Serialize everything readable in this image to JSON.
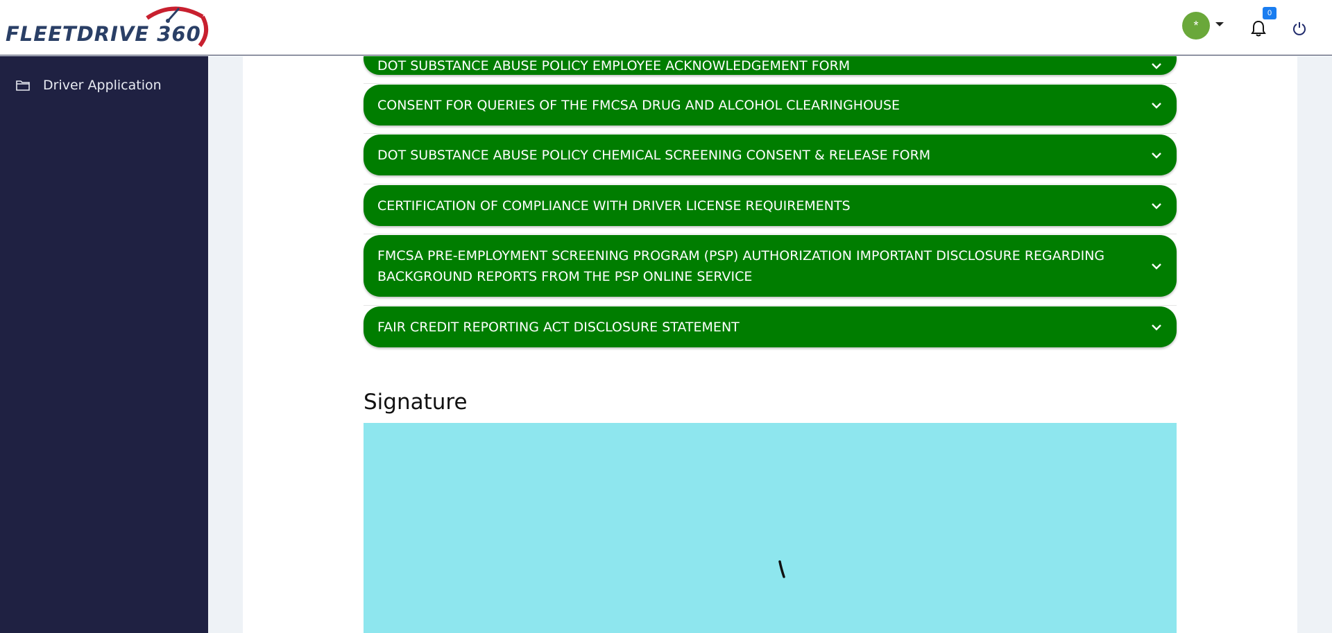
{
  "header": {
    "logo_text": "FLEETDRIVE 360",
    "avatar_glyph": "*",
    "notification_count": "0",
    "icons": [
      "dropdown-caret-icon",
      "bell-icon",
      "power-icon"
    ],
    "colors": {
      "avatar": "#6aa83a",
      "badge": "#1a7df0"
    }
  },
  "sidebar": {
    "items": [
      {
        "label": "Driver Application",
        "icon": "folder-icon"
      }
    ],
    "colors": {
      "background": "#1f2142"
    }
  },
  "accordions": [
    {
      "title": "DOT SUBSTANCE ABUSE POLICY EMPLOYEE ACKNOWLEDGEMENT FORM"
    },
    {
      "title": "CONSENT FOR QUERIES OF THE FMCSA DRUG AND ALCOHOL CLEARINGHOUSE"
    },
    {
      "title": "DOT SUBSTANCE ABUSE POLICY CHEMICAL SCREENING CONSENT & RELEASE FORM"
    },
    {
      "title": "CERTIFICATION OF COMPLIANCE WITH DRIVER LICENSE REQUIREMENTS"
    },
    {
      "title": "FMCSA PRE-EMPLOYMENT SCREENING PROGRAM (PSP) AUTHORIZATION IMPORTANT DISCLOSURE REGARDING BACKGROUND REPORTS FROM THE PSP ONLINE SERVICE"
    },
    {
      "title": "FAIR CREDIT REPORTING ACT DISCLOSURE STATEMENT"
    }
  ],
  "accordion_color": "#007d00",
  "signature": {
    "heading": "Signature",
    "pad_color": "#8ee6ee"
  }
}
